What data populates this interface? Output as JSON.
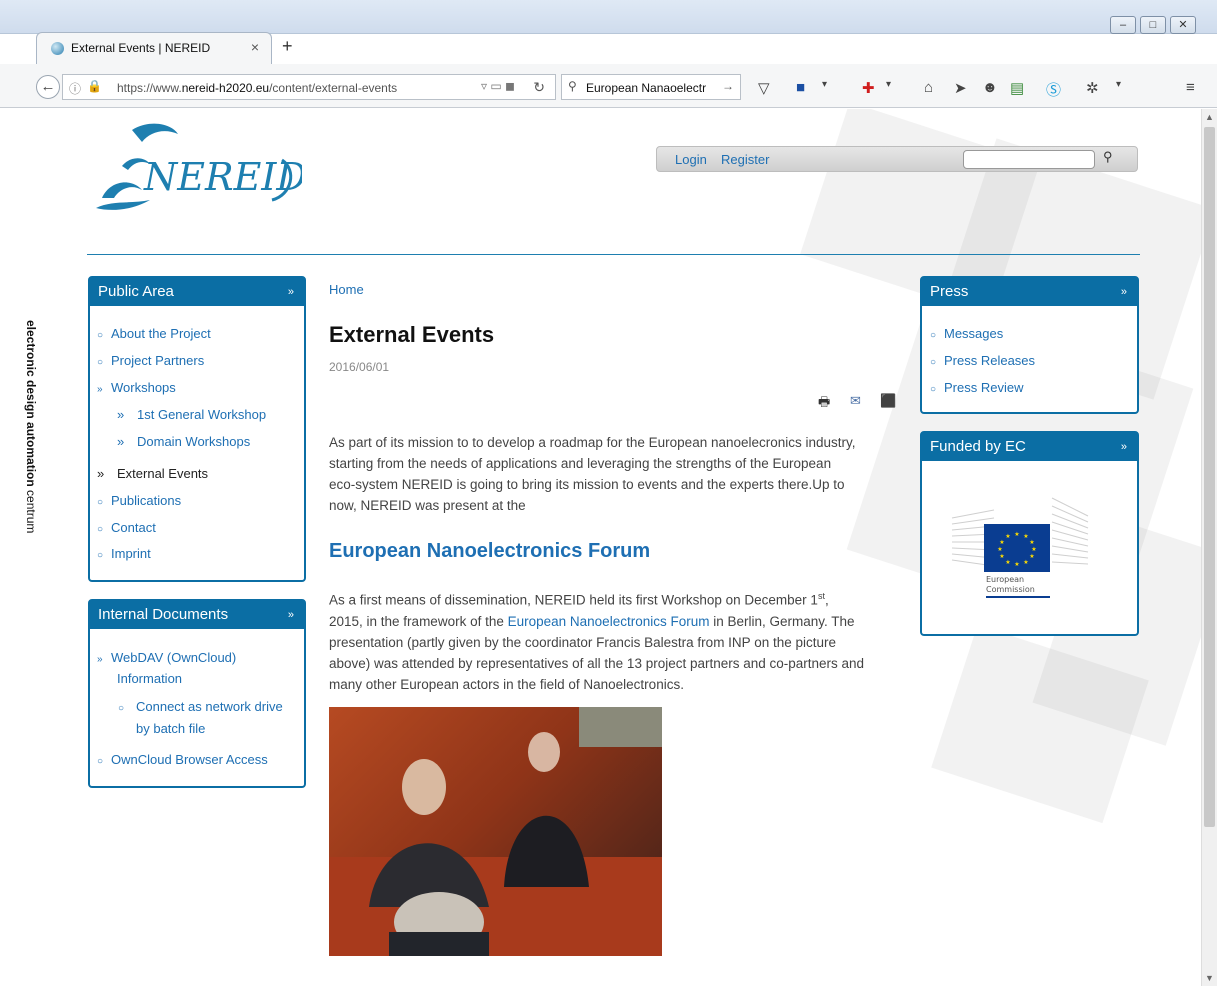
{
  "browser": {
    "tab_title": "External Events | NEREID",
    "new_tab": "+",
    "url_prefix": "https://www.",
    "url_domain": "nereid-h2020.eu",
    "url_path": "/content/external-events",
    "search_text": "European Nanaoelectr"
  },
  "site": {
    "logo_text": "NEREID",
    "header": {
      "login": "Login",
      "register": "Register"
    },
    "side_label_bold": "electronic design automation",
    "side_label_light": "centrum"
  },
  "left": {
    "public_area": {
      "title": "Public Area",
      "items": [
        "About the Project",
        "Project Partners",
        "Workshops",
        "1st General Workshop",
        "Domain Workshops",
        "External Events",
        "Publications",
        "Contact",
        "Imprint"
      ]
    },
    "internal_docs": {
      "title": "Internal Documents",
      "items": [
        "WebDAV (OwnCloud)",
        "Information",
        "Connect as network drive",
        "by batch file",
        "OwnCloud Browser Access"
      ]
    }
  },
  "main": {
    "breadcrumb": "Home",
    "title": "External Events",
    "date": "2016/06/01",
    "intro": [
      "As part of its mission to to develop a roadmap for the European nanoelecronics industry,",
      "starting from the needs of applications and leveraging the strengths of the European",
      "eco-system NEREID is going to bring its mission to events and the experts there.Up to",
      "now, NEREID was present at the"
    ],
    "section_title": "European Nanoelectronics Forum",
    "body_1a": "As a first means of dissemination, NEREID held its first Workshop on December 1",
    "body_1sup": "st",
    "body_1b": ",",
    "body_2a": "2015, in the framework of the ",
    "body_2link": "European Nanoelectronics Forum",
    "body_2b": " in Berlin, Germany. The",
    "body_3": "presentation (partly given by the coordinator Francis Balestra from INP on the picture",
    "body_4": "above) was attended by representatives of all the 13 project partners and co-partners and",
    "body_5": "many other European actors in the field of Nanoelectronics."
  },
  "right": {
    "press": {
      "title": "Press",
      "items": [
        "Messages",
        "Press Releases",
        "Press Review"
      ]
    },
    "funded": {
      "title": "Funded by EC",
      "ec_line1": "European",
      "ec_line2": "Commission"
    }
  }
}
